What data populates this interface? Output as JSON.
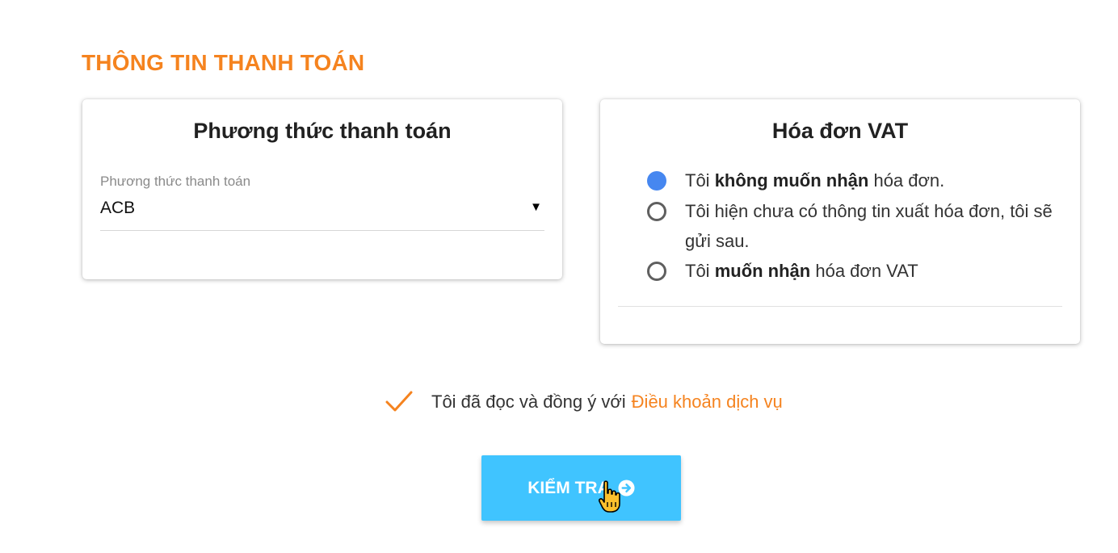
{
  "page": {
    "title": "THÔNG TIN THANH TOÁN"
  },
  "payment": {
    "title": "Phương thức thanh toán",
    "select_label": "Phương thức thanh toán",
    "select_value": "ACB",
    "select_arrow": "▼"
  },
  "vat": {
    "title": "Hóa đơn VAT",
    "options": [
      {
        "prefix": "Tôi ",
        "bold": "không muốn nhận",
        "suffix": " hóa đơn.",
        "selected": true
      },
      {
        "prefix": "Tôi hiện chưa có thông tin xuất hóa đơn, tôi sẽ gửi sau.",
        "bold": "",
        "suffix": "",
        "selected": false
      },
      {
        "prefix": "Tôi ",
        "bold": "muốn nhận",
        "suffix": " hóa đơn VAT",
        "selected": false
      }
    ]
  },
  "terms": {
    "text": "Tôi đã đọc và đồng ý với",
    "link": "Điều khoản dịch vụ",
    "checked": true
  },
  "submit": {
    "label": "KIỂM TRA"
  },
  "colors": {
    "accent": "#f5831f",
    "button": "#40c4ff",
    "radio_selected": "#4687f0"
  },
  "icons": [
    "check-icon",
    "arrow-circle-right-icon",
    "hand-pointer-cursor-icon",
    "dropdown-arrow-icon"
  ]
}
